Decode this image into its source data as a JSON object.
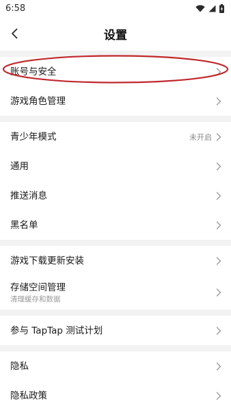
{
  "status_bar": {
    "time": "6:58",
    "icons": [
      "wifi-icon",
      "signal-icon",
      "battery-charging-icon"
    ]
  },
  "header": {
    "title": "设置",
    "back_icon": "chevron-left-icon"
  },
  "sections": [
    {
      "items": [
        {
          "label": "账号与安全",
          "highlighted": true
        },
        {
          "label": "游戏角色管理"
        }
      ]
    },
    {
      "items": [
        {
          "label": "青少年模式",
          "value": "未开启"
        },
        {
          "label": "通用"
        },
        {
          "label": "推送消息"
        },
        {
          "label": "黑名单"
        }
      ]
    },
    {
      "items": [
        {
          "label": "游戏下载更新安装"
        },
        {
          "label": "存储空间管理",
          "subtitle": "清理缓存和数据"
        }
      ]
    },
    {
      "items": [
        {
          "label": "参与 TapTap 测试计划"
        }
      ]
    },
    {
      "items": [
        {
          "label": "隐私"
        },
        {
          "label": "隐私政策"
        }
      ]
    }
  ],
  "colors": {
    "section_gap": "#f2f2f2",
    "highlight_ellipse": "#c0282d",
    "chevron": "#9a9a9a"
  }
}
